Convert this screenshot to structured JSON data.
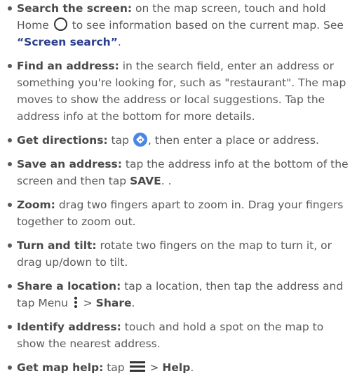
{
  "items": [
    {
      "term": "Search the screen:",
      "t1": " on the map screen, touch and hold Home ",
      "t2": " to see information based on the current map. See ",
      "link": "“Screen search”",
      "t3": "."
    },
    {
      "term": "Find an address:",
      "text": " in the search field, enter an address or something you're looking for, such as \"restaurant\". The map moves to show the address or local suggestions. Tap the address info at the bottom for more details."
    },
    {
      "term": "Get directions:",
      "t1": " tap ",
      "t2": ", then enter a place or address."
    },
    {
      "term": "Save an address:",
      "t1": " tap the address info at the bottom of the screen and then tap ",
      "bold": "SAVE",
      "t2": ". ."
    },
    {
      "term": "Zoom:",
      "text": " drag two fingers apart to zoom in. Drag your fingers together to zoom out."
    },
    {
      "term": "Turn and tilt:",
      "text": " rotate two fingers on the map to turn it, or drag up/down to tilt."
    },
    {
      "term": "Share a location:",
      "t1": " tap a location, then tap the address and tap Menu ",
      "t2": " > ",
      "bold": "Share",
      "t3": "."
    },
    {
      "term": "Identify address:",
      "text": " touch and hold a spot on the map to show the nearest address."
    },
    {
      "term": "Get map help:",
      "t1": " tap ",
      "t2": " > ",
      "bold": "Help",
      "t3": "."
    }
  ],
  "icons": {
    "home": "home-circle-icon",
    "directions": "directions-icon",
    "menu": "menu-dots-icon",
    "hamburger": "hamburger-menu-icon"
  },
  "colors": {
    "text": "#595959",
    "term": "#4a4a4a",
    "link": "#2b3f8c",
    "directions_icon": "#4a86e8"
  }
}
